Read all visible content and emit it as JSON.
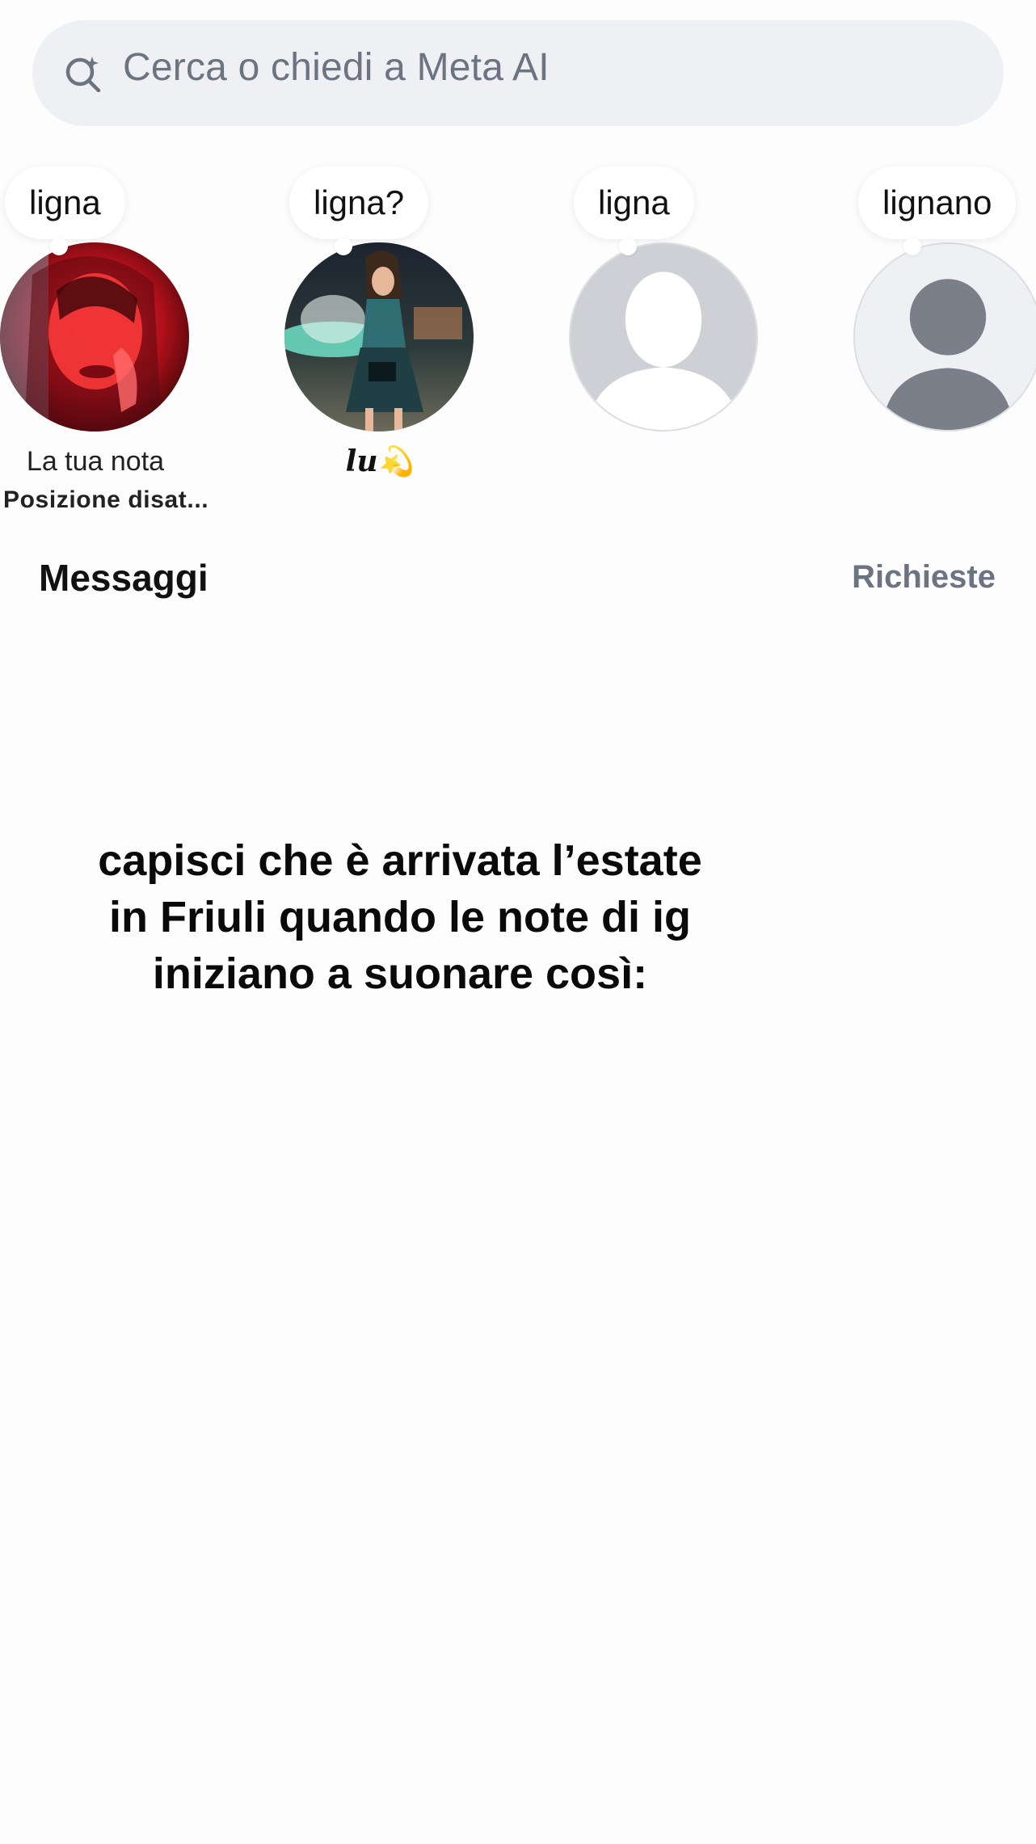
{
  "search": {
    "placeholder": "Cerca o chiedi a Meta AI",
    "icon": "search-sparkle-icon"
  },
  "notes": [
    {
      "note_text": "ligna",
      "label": "La tua nota",
      "sublabel": "Posizione disat...",
      "avatar": "profile-photo-red-light"
    },
    {
      "note_text": "ligna?",
      "name": "lu💫",
      "avatar": "profile-photo-fountain"
    },
    {
      "note_text": "ligna",
      "avatar": "default-silhouette-icon"
    },
    {
      "note_text": "lignano",
      "avatar": "default-user-icon"
    }
  ],
  "messages": {
    "title": "Messaggi",
    "requests_label": "Richieste"
  },
  "overlay": {
    "caption": "capisci che è arrivata l’estate in Friuli quando le note di ig iniziano a suonare così:"
  },
  "colors": {
    "search_bg": "#eef0f3",
    "muted_text": "#6b7480",
    "background": "#fdfdfd"
  }
}
